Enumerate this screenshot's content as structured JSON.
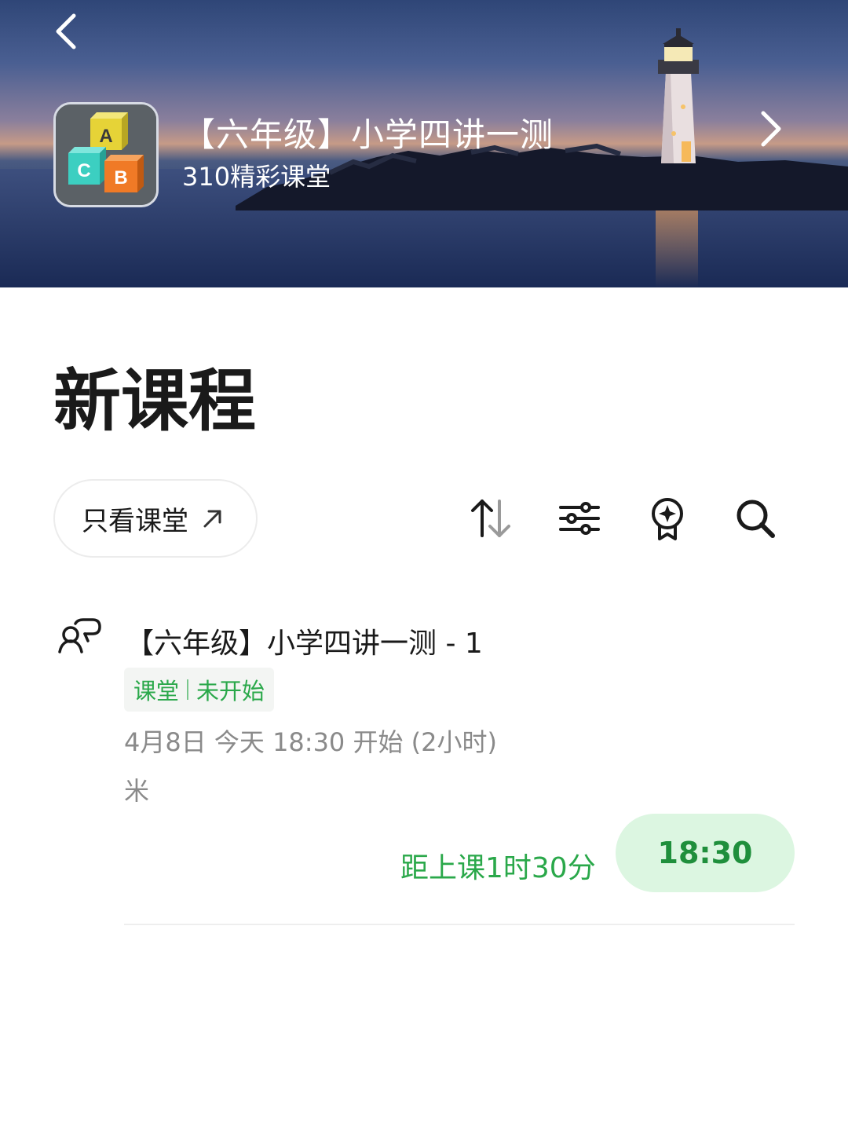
{
  "header": {
    "title": "【六年级】小学四讲一测",
    "subtitle": "310精彩课堂",
    "back_icon": "chevron-left-icon",
    "forward_icon": "chevron-right-icon",
    "app_icon": "abc-blocks-icon",
    "app_icon_letters": [
      "A",
      "C",
      "B"
    ]
  },
  "main": {
    "title": "新课程",
    "filter_chip": {
      "label": "只看课堂",
      "icon": "arrow-up-right-icon"
    },
    "toolbar": [
      {
        "name": "sort",
        "icon": "sort-arrows-icon"
      },
      {
        "name": "filter",
        "icon": "sliders-icon"
      },
      {
        "name": "badge",
        "icon": "award-icon"
      },
      {
        "name": "search",
        "icon": "search-icon"
      }
    ],
    "course": {
      "icon": "classroom-icon",
      "title": "【六年级】小学四讲一测 - 1",
      "tags": [
        "课堂",
        "未开始"
      ],
      "time": "4月8日 今天 18:30  开始 (2小时)",
      "teacher": "米",
      "countdown": "距上课1时30分",
      "start_time": "18:30"
    }
  },
  "colors": {
    "accent_green": "#2aa84a",
    "button_bg": "#dcf6e1",
    "text_primary": "#1a1a1a",
    "text_secondary": "#8a8a8a"
  }
}
